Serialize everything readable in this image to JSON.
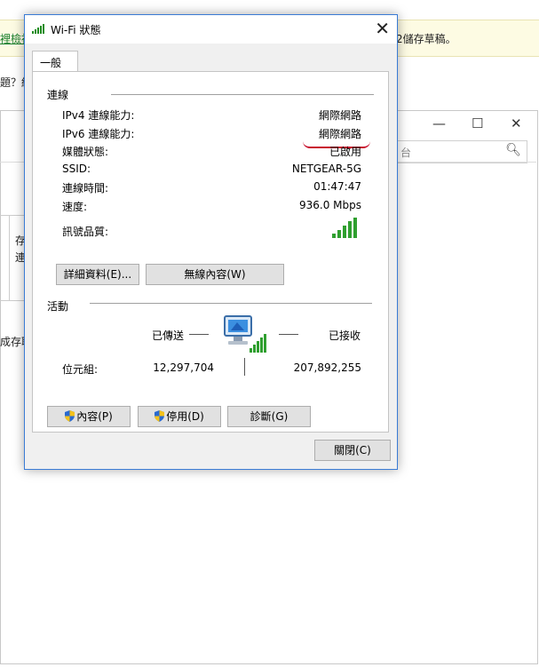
{
  "background": {
    "banner_left": "裡檢視",
    "banner_right": "2儲存草稿。",
    "question_text": "題？紛",
    "search_placeholder": "台",
    "side_text_1": "存",
    "side_text_2": "連",
    "side_text_3": "成存取"
  },
  "dialog": {
    "title": "Wi-Fi 狀態",
    "tab_general": "一般",
    "connection": {
      "section_title": "連線",
      "rows": [
        {
          "label": "IPv4 連線能力:",
          "value": "網際網路"
        },
        {
          "label": "IPv6 連線能力:",
          "value": "網際網路"
        },
        {
          "label": "媒體狀態:",
          "value": "已啟用"
        },
        {
          "label": "SSID:",
          "value": "NETGEAR-5G"
        },
        {
          "label": "連線時間:",
          "value": "01:47:47"
        },
        {
          "label": "速度:",
          "value": "936.0 Mbps"
        }
      ],
      "signal_label": "訊號品質:",
      "signal_bars": 5,
      "details_button": "詳細資料(E)...",
      "wireless_props_button": "無線內容(W)"
    },
    "activity": {
      "section_title": "活動",
      "sent_label": "已傳送",
      "received_label": "已接收",
      "bytes_label": "位元組:",
      "bytes_sent": "12,297,704",
      "bytes_received": "207,892,255"
    },
    "properties_button": "內容(P)",
    "disable_button": "停用(D)",
    "diagnose_button": "診斷(G)",
    "close_button": "關閉(C)"
  }
}
